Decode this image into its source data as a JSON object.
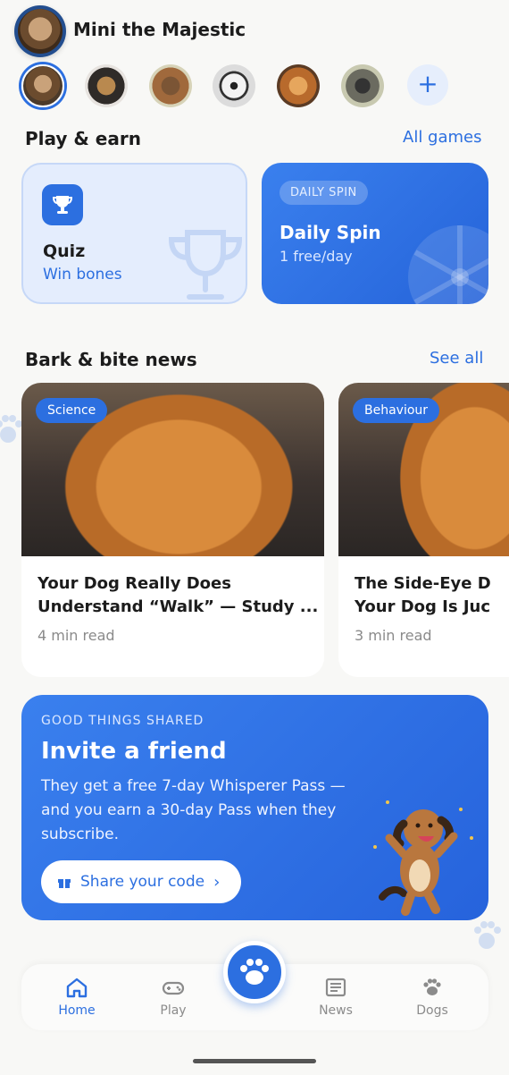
{
  "profile": {
    "name": "Mini the Majestic"
  },
  "play": {
    "title": "Play & earn",
    "link": "All games",
    "quiz": {
      "title": "Quiz",
      "subtitle": "Win bones"
    },
    "spin": {
      "badge": "DAILY SPIN",
      "title": "Daily Spin",
      "subtitle": "1 free/day"
    }
  },
  "news": {
    "title": "Bark & bite news",
    "link": "See all",
    "articles": [
      {
        "tag": "Science",
        "title_line1": "Your Dog Really Does",
        "title_line2": "Understand “Walk” — Study ...",
        "meta": "4 min read"
      },
      {
        "tag": "Behaviour",
        "title_line1": "The Side-Eye D",
        "title_line2": "Your Dog Is Juc",
        "meta": "3 min read"
      }
    ]
  },
  "invite": {
    "kicker": "GOOD THINGS SHARED",
    "title": "Invite a friend",
    "body": "They get a free 7-day Whisperer Pass — and you earn a 30-day Pass when they subscribe.",
    "button": "Share your code"
  },
  "nav": {
    "home": "Home",
    "play": "Play",
    "news": "News",
    "dogs": "Dogs"
  },
  "colors": {
    "accent": "#2c6fe0",
    "background": "#f8f8f6"
  }
}
